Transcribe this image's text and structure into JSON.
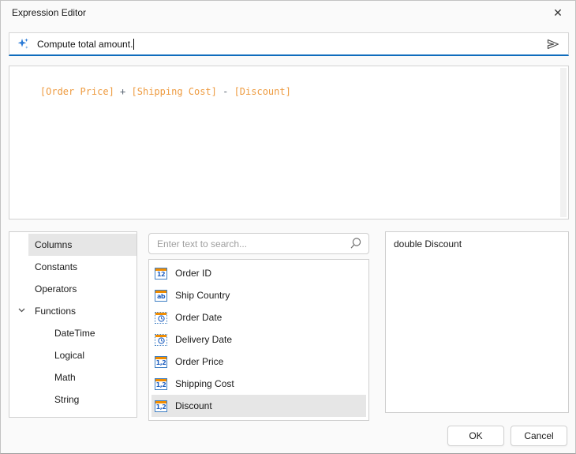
{
  "dialog": {
    "title": "Expression Editor",
    "close_glyph": "✕"
  },
  "ai_prompt": {
    "value": "Compute total amount.",
    "sparkle_icon": "ai-sparkle-icon",
    "send_icon": "send-icon"
  },
  "expression": {
    "tokens": [
      {
        "text": "[Order Price]",
        "type": "column"
      },
      {
        "text": " + ",
        "type": "operator"
      },
      {
        "text": "[Shipping Cost]",
        "type": "column"
      },
      {
        "text": " - ",
        "type": "operator"
      },
      {
        "text": "[Discount]",
        "type": "column"
      }
    ]
  },
  "category_tree": {
    "items": [
      {
        "label": "Columns",
        "level": 0,
        "selected": true,
        "expanded": false
      },
      {
        "label": "Constants",
        "level": 0,
        "selected": false,
        "expanded": false
      },
      {
        "label": "Operators",
        "level": 0,
        "selected": false,
        "expanded": false
      },
      {
        "label": "Functions",
        "level": 0,
        "selected": false,
        "expanded": true
      },
      {
        "label": "DateTime",
        "level": 1,
        "selected": false,
        "expanded": false
      },
      {
        "label": "Logical",
        "level": 1,
        "selected": false,
        "expanded": false
      },
      {
        "label": "Math",
        "level": 1,
        "selected": false,
        "expanded": false
      },
      {
        "label": "String",
        "level": 1,
        "selected": false,
        "expanded": false
      }
    ]
  },
  "search": {
    "placeholder": "Enter text to search...",
    "icon": "search-icon"
  },
  "columns_list": {
    "items": [
      {
        "label": "Order ID",
        "dtype": "integer",
        "glyph": "12",
        "selected": false
      },
      {
        "label": "Ship Country",
        "dtype": "string",
        "glyph": "ab",
        "selected": false
      },
      {
        "label": "Order Date",
        "dtype": "datetime",
        "glyph": "clock",
        "selected": false
      },
      {
        "label": "Delivery Date",
        "dtype": "datetime",
        "glyph": "clock",
        "selected": false
      },
      {
        "label": "Order Price",
        "dtype": "decimal",
        "glyph": "1,2",
        "selected": false
      },
      {
        "label": "Shipping Cost",
        "dtype": "decimal",
        "glyph": "1,2",
        "selected": false
      },
      {
        "label": "Discount",
        "dtype": "decimal",
        "glyph": "1,2",
        "selected": true
      }
    ]
  },
  "description_panel": {
    "text": "double Discount"
  },
  "footer": {
    "ok_label": "OK",
    "cancel_label": "Cancel"
  },
  "colors": {
    "accent_blue": "#0f6cbd",
    "column_orange": "#ee9b40",
    "operator_gray": "#5a6673",
    "icon_blue": "#2060c0",
    "icon_orange": "#f08c00",
    "selection_gray": "#e6e6e6"
  }
}
